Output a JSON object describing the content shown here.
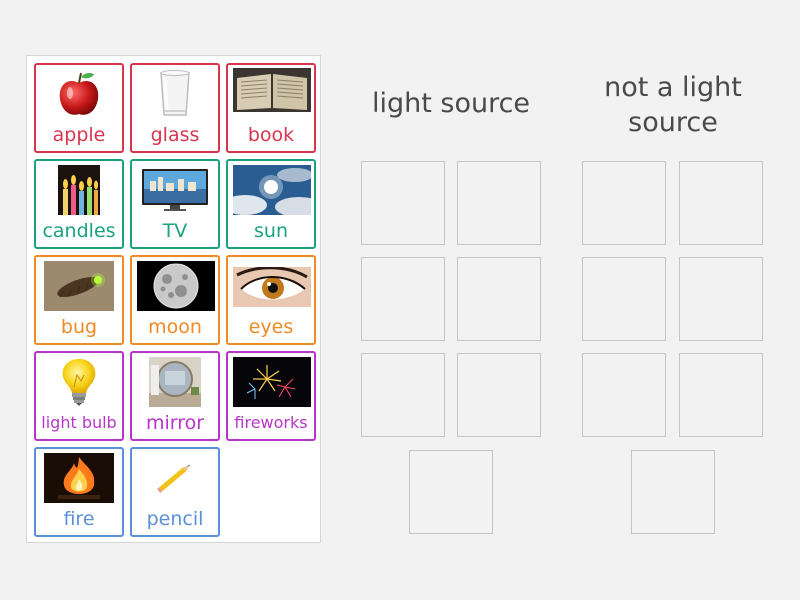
{
  "headings": {
    "light_source": "light source",
    "not_light_source": "not a light source"
  },
  "colors": {
    "red": "#d9354e",
    "green": "#1aa37a",
    "orange": "#f08a24",
    "purple": "#b735c8",
    "blue": "#5b8fd9"
  },
  "cards": [
    {
      "label": "apple",
      "icon": "apple-icon",
      "color": "#d9354e"
    },
    {
      "label": "glass",
      "icon": "glass-icon",
      "color": "#d9354e"
    },
    {
      "label": "book",
      "icon": "book-icon",
      "color": "#d9354e"
    },
    {
      "label": "candles",
      "icon": "candles-icon",
      "color": "#1aa37a"
    },
    {
      "label": "TV",
      "icon": "tv-icon",
      "color": "#1aa37a"
    },
    {
      "label": "sun",
      "icon": "sun-icon",
      "color": "#1aa37a"
    },
    {
      "label": "bug",
      "icon": "bug-icon",
      "color": "#f08a24"
    },
    {
      "label": "moon",
      "icon": "moon-icon",
      "color": "#f08a24"
    },
    {
      "label": "eyes",
      "icon": "eye-icon",
      "color": "#f08a24"
    },
    {
      "label": "light bulb",
      "icon": "light-bulb-icon",
      "color": "#b735c8"
    },
    {
      "label": "mirror",
      "icon": "mirror-icon",
      "color": "#b735c8"
    },
    {
      "label": "fireworks",
      "icon": "fireworks-icon",
      "color": "#b735c8"
    },
    {
      "label": "fire",
      "icon": "fire-icon",
      "color": "#5b8fd9"
    },
    {
      "label": "pencil",
      "icon": "pencil-icon",
      "color": "#5b8fd9"
    }
  ]
}
